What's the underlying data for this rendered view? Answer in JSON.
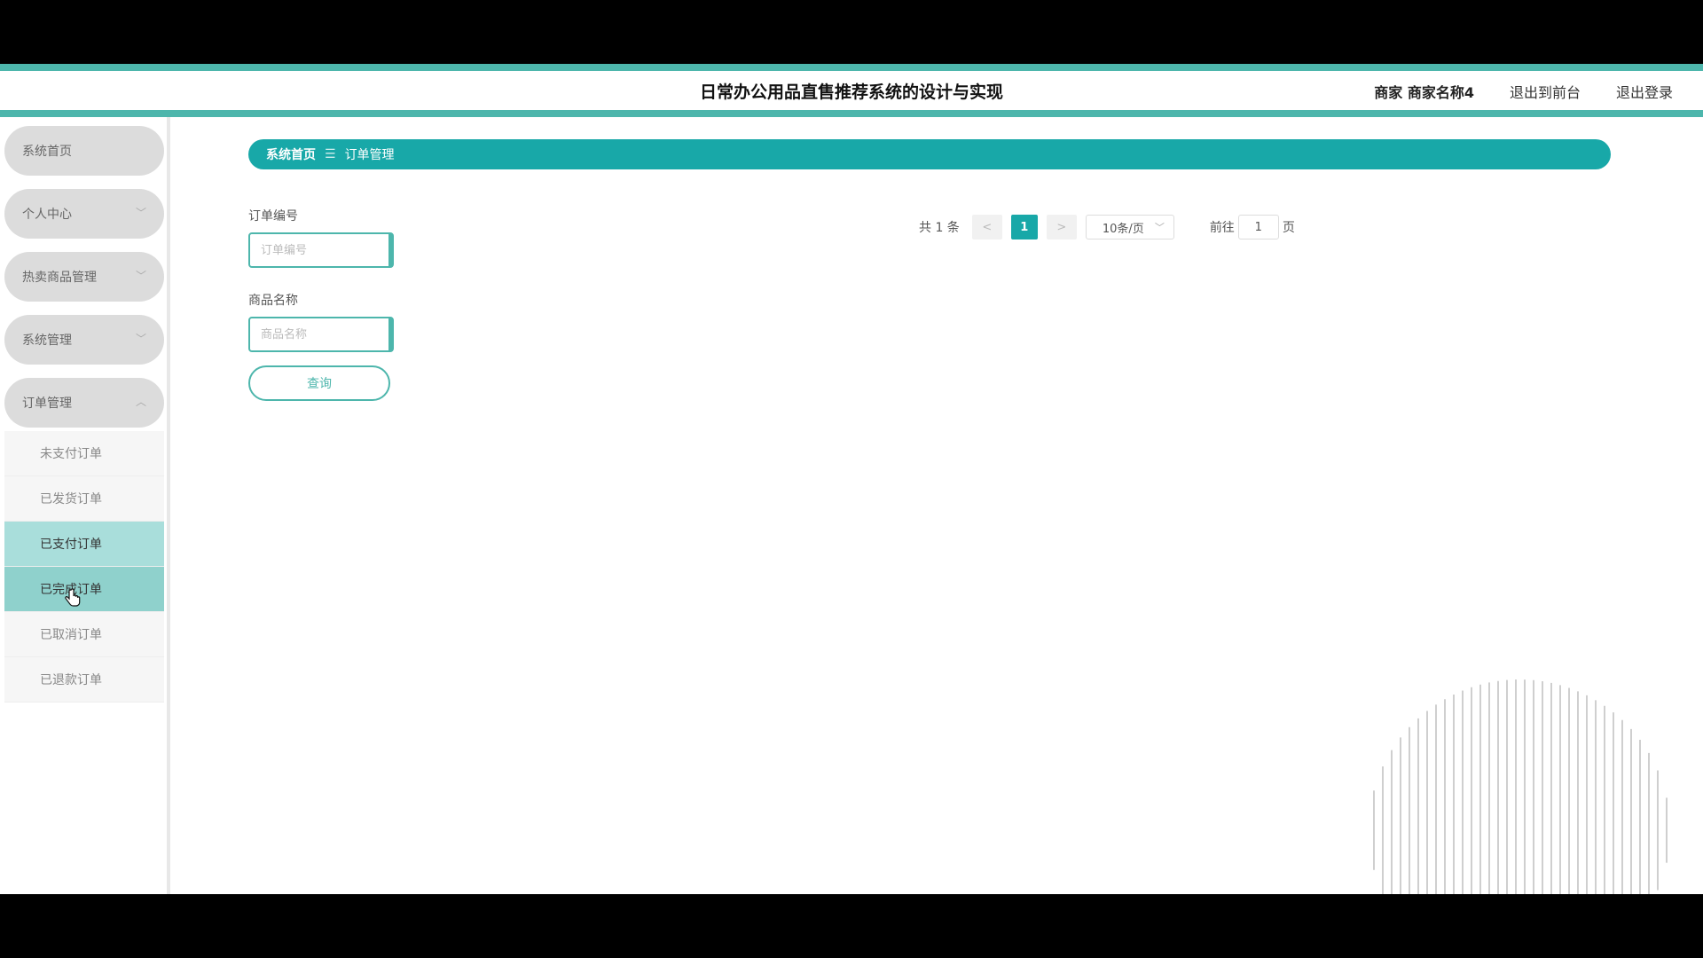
{
  "header": {
    "title": "日常办公用品直售推荐系统的设计与实现",
    "user_label": "商家 商家名称4",
    "to_front_label": "退出到前台",
    "logout_label": "退出登录"
  },
  "sidebar": {
    "items": [
      {
        "label": "系统首页",
        "chevron": ""
      },
      {
        "label": "个人中心",
        "chevron": "﹀"
      },
      {
        "label": "热卖商品管理",
        "chevron": "﹀"
      },
      {
        "label": "系统管理",
        "chevron": "﹀"
      },
      {
        "label": "订单管理",
        "chevron": "︿"
      }
    ],
    "sub_items": [
      {
        "label": "未支付订单"
      },
      {
        "label": "已发货订单"
      },
      {
        "label": "已支付订单"
      },
      {
        "label": "已完成订单"
      },
      {
        "label": "已取消订单"
      },
      {
        "label": "已退款订单"
      }
    ]
  },
  "breadcrumb": {
    "home": "系统首页",
    "separator": "☰",
    "current": "订单管理"
  },
  "search": {
    "order_no_label": "订单编号",
    "order_no_placeholder": "订单编号",
    "order_no_value": "",
    "product_label": "商品名称",
    "product_placeholder": "商品名称",
    "product_value": "",
    "query_label": "查询"
  },
  "pagination": {
    "total_text": "共 1 条",
    "prev_symbol": "<",
    "current_page": "1",
    "next_symbol": ">",
    "page_size": "10条/页",
    "goto_prefix": "前往",
    "goto_value": "1",
    "goto_suffix": "页"
  },
  "colors": {
    "accent": "#18a8a8",
    "accent_light": "#4db6ac",
    "menu_bg": "#dcdcdc",
    "active_sub_1": "#a9dedb",
    "active_sub_2": "#8fd1cc"
  },
  "icons": {
    "menu_chevron": "chevron-down-icon",
    "breadcrumb_separator": "menu-icon",
    "cursor": "hand-pointer-icon"
  }
}
